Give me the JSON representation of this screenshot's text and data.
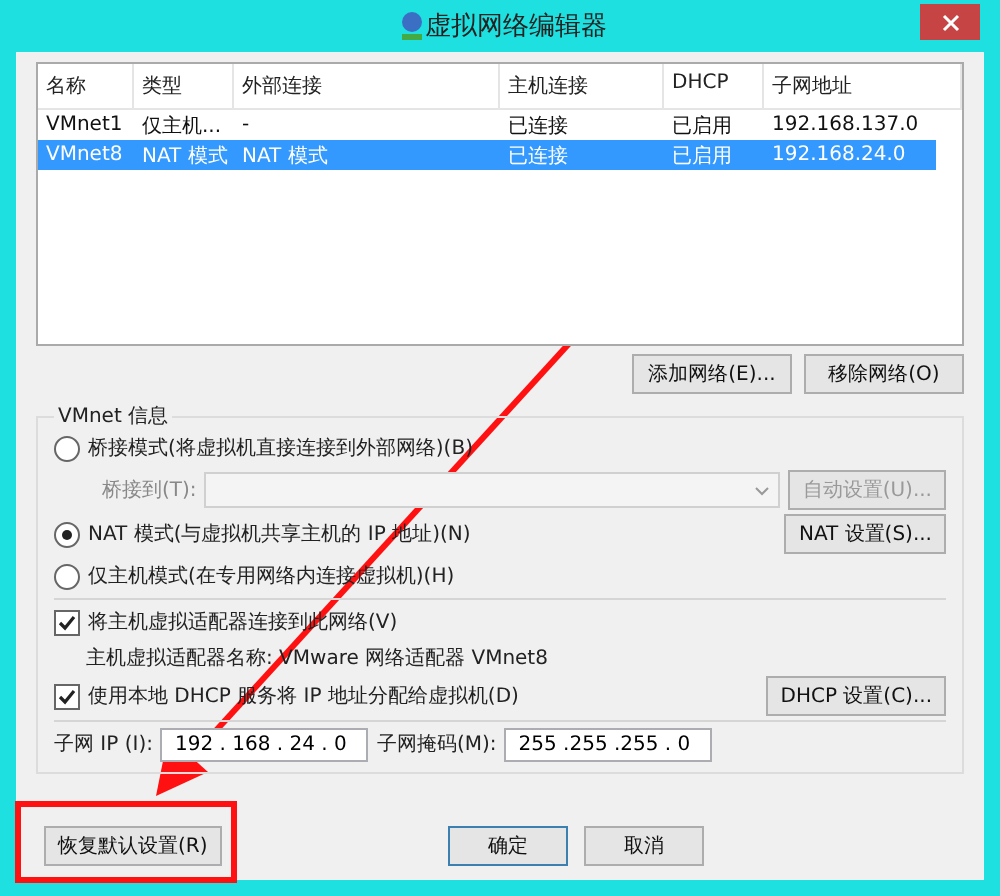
{
  "window": {
    "title": "虚拟网络编辑器"
  },
  "table": {
    "columns": [
      "名称",
      "类型",
      "外部连接",
      "主机连接",
      "DHCP",
      "子网地址"
    ],
    "rows": [
      {
        "cells": [
          "VMnet1",
          "仅主机...",
          "-",
          "已连接",
          "已启用",
          "192.168.137.0"
        ],
        "selected": false
      },
      {
        "cells": [
          "VMnet8",
          "NAT 模式",
          "NAT 模式",
          "已连接",
          "已启用",
          "192.168.24.0"
        ],
        "selected": true
      }
    ]
  },
  "table_buttons": [
    {
      "label": "添加网络(E)..."
    },
    {
      "label": "移除网络(O)"
    }
  ],
  "vmnet_info": {
    "title": "VMnet 信息",
    "bridged": {
      "label": "桥接模式(将虚拟机直接连接到外部网络)(B)",
      "selected": false
    },
    "bridge_to": {
      "label": "桥接到(T):",
      "disabled": true
    },
    "auto_button": {
      "label": "自动设置(U)...",
      "disabled": true
    },
    "nat": {
      "label": "NAT 模式(与虚拟机共享主机的 IP 地址)(N)",
      "selected": true
    },
    "nat_button": {
      "label": "NAT 设置(S)..."
    },
    "host_only": {
      "label": "仅主机模式(在专用网络内连接虚拟机)(H)",
      "selected": false
    },
    "connect_adapter": {
      "label": "将主机虚拟适配器连接到此网络(V)",
      "checked": true
    },
    "adapter_name": "主机虚拟适配器名称: VMware 网络适配器 VMnet8",
    "dhcp": {
      "label": "使用本地 DHCP 服务将 IP 地址分配给虚拟机(D)",
      "checked": true
    },
    "dhcp_button": {
      "label": "DHCP 设置(C)..."
    },
    "subnet_ip": {
      "label": "子网 IP (I):",
      "value": "192 . 168 . 24 . 0"
    },
    "subnet_mask": {
      "label": "子网掩码(M):",
      "value": "255 .255 .255 . 0"
    }
  },
  "footer": {
    "restore": "恢复默认设置(R)",
    "ok": "确定",
    "cancel": "取消"
  }
}
